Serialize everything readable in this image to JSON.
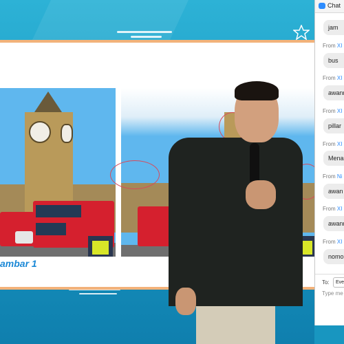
{
  "chat": {
    "title": "Chat",
    "messages": [
      {
        "from_prefix": "",
        "sender": "",
        "text": "jam"
      },
      {
        "from_prefix": "From ",
        "sender": "XI",
        "text": "bus"
      },
      {
        "from_prefix": "From ",
        "sender": "XI",
        "text": "awanr"
      },
      {
        "from_prefix": "From ",
        "sender": "XI",
        "text": "pillar"
      },
      {
        "from_prefix": "From ",
        "sender": "XI",
        "text": "Mena"
      },
      {
        "from_prefix": "From ",
        "sender": "Ni",
        "text": "awan"
      },
      {
        "from_prefix": "From ",
        "sender": "XI",
        "text": "awanr"
      },
      {
        "from_prefix": "From ",
        "sender": "XI",
        "text": "nomo"
      }
    ],
    "to_label": "To:",
    "to_value": "Eve",
    "input_placeholder": "Type me"
  },
  "slide": {
    "caption": "ambar 1"
  },
  "colors": {
    "accent": "#2d8cff",
    "slide_border": "#f2b27a",
    "caption": "#1b88d6",
    "background": "#1aa0c8"
  }
}
